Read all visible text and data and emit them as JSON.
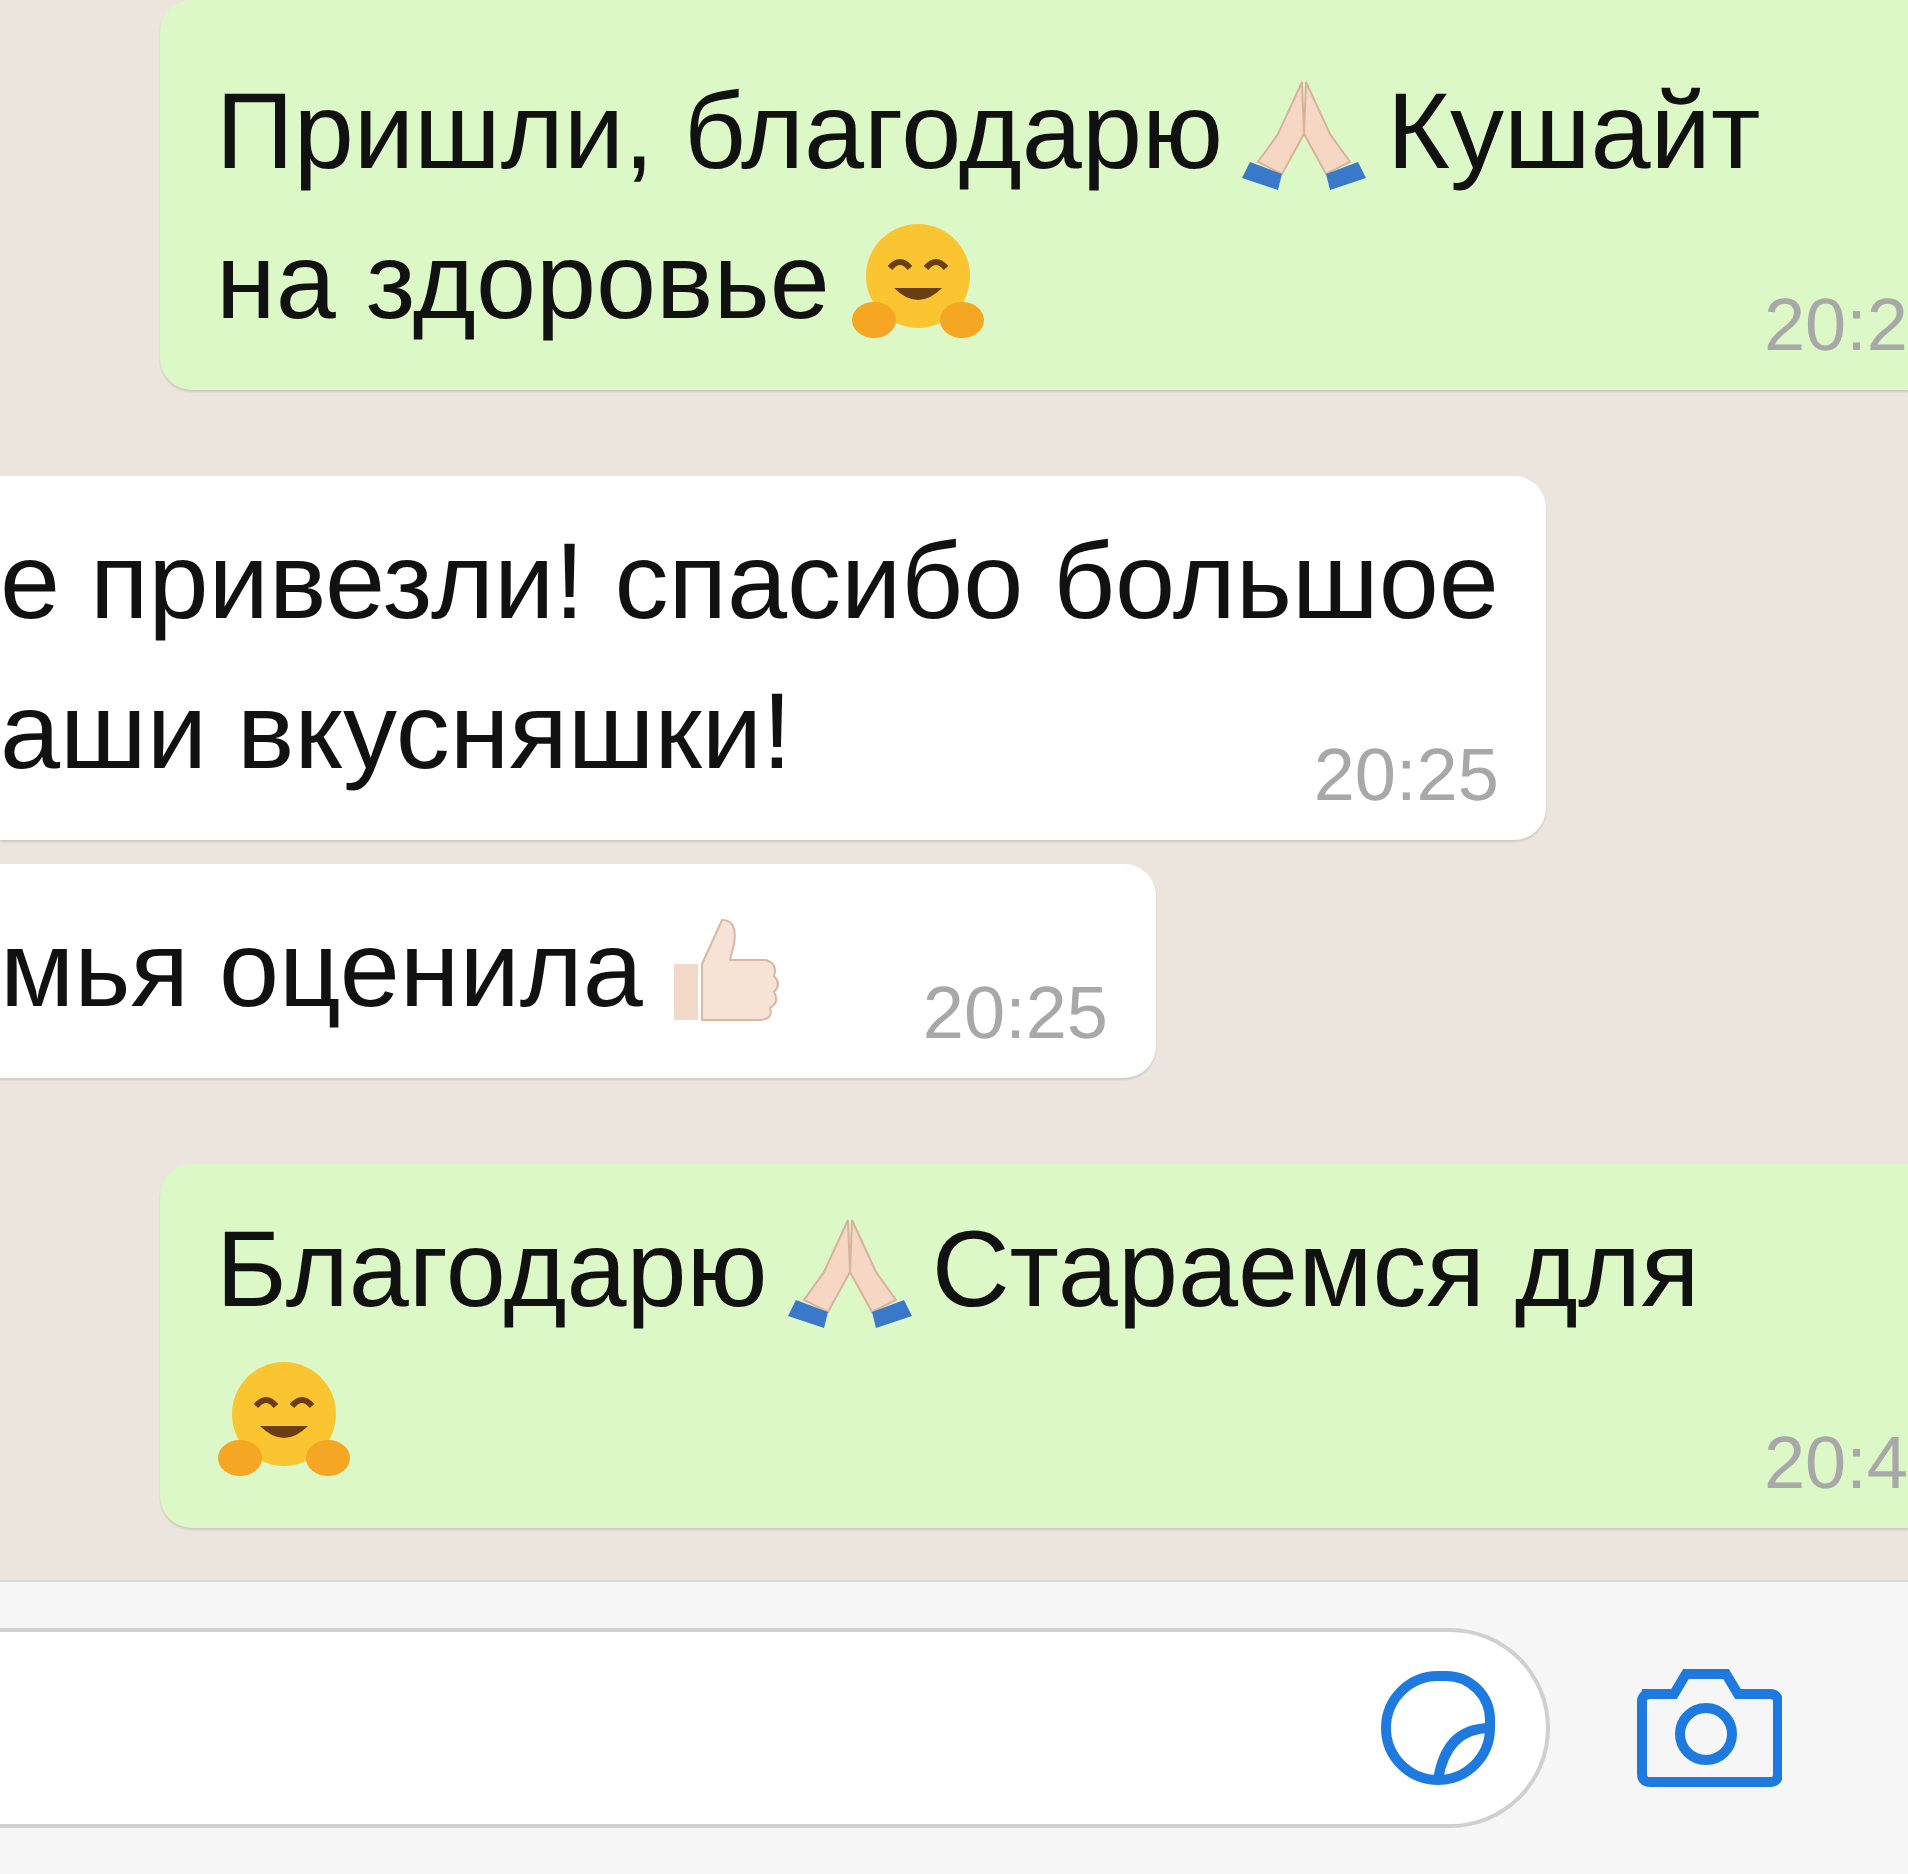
{
  "messages": [
    {
      "kind": "outgoing",
      "time": "20:2",
      "lines": [
        [
          {
            "kind": "text",
            "text": "Пришли, благодарю"
          },
          {
            "kind": "pray"
          },
          {
            "kind": "text",
            "text": "Кушайт"
          }
        ],
        [
          {
            "kind": "text",
            "text": "на здоровье"
          },
          {
            "kind": "hug"
          }
        ]
      ]
    },
    {
      "kind": "incoming",
      "time": "20:25",
      "lines": [
        [
          {
            "kind": "text",
            "text": "е привезли! спасибо большое"
          }
        ],
        [
          {
            "kind": "text",
            "text": "аши вкусняшки!"
          }
        ]
      ]
    },
    {
      "kind": "incoming",
      "time": "20:25",
      "lines": [
        [
          {
            "kind": "text",
            "text": "мья оценила"
          },
          {
            "kind": "thumb"
          }
        ]
      ]
    },
    {
      "kind": "outgoing",
      "time": "20:4",
      "lines": [
        [
          {
            "kind": "text",
            "text": "Благодарю"
          },
          {
            "kind": "pray"
          },
          {
            "kind": "text",
            "text": "Стараемся для"
          }
        ],
        [
          {
            "kind": "hug"
          }
        ]
      ]
    }
  ],
  "composer": {
    "field": {
      "kind": "input"
    }
  }
}
